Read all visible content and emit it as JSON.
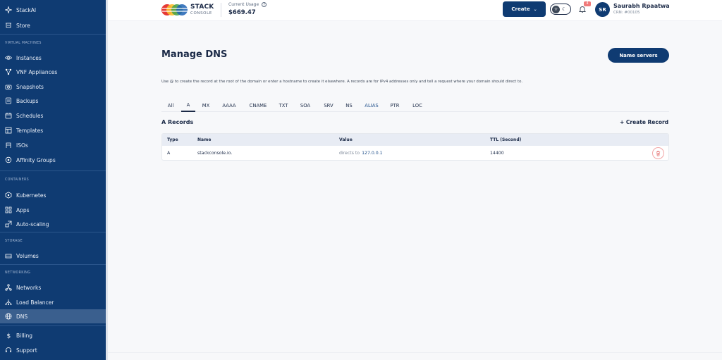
{
  "sidebar": {
    "top_items": [
      {
        "label": "StackAI",
        "icon": "sparkle-icon"
      },
      {
        "label": "Store",
        "icon": "store-icon"
      }
    ],
    "sections": [
      {
        "title": "VIRTUAL MACHINES",
        "items": [
          {
            "label": "Instances",
            "icon": "eye-icon"
          },
          {
            "label": "VNF Appliances",
            "icon": "nodes-icon"
          },
          {
            "label": "Snapshots",
            "icon": "camera-icon"
          },
          {
            "label": "Backups",
            "icon": "backup-icon"
          },
          {
            "label": "Schedules",
            "icon": "calendar-icon"
          },
          {
            "label": "Templates",
            "icon": "template-icon"
          },
          {
            "label": "ISOs",
            "icon": "disc-icon"
          },
          {
            "label": "Affinity Groups",
            "icon": "affinity-icon"
          }
        ]
      },
      {
        "title": "CONTAINERS",
        "items": [
          {
            "label": "Kubernetes",
            "icon": "kubernetes-icon"
          },
          {
            "label": "Apps",
            "icon": "apps-icon"
          },
          {
            "label": "Auto-scaling",
            "icon": "autoscale-icon"
          }
        ]
      },
      {
        "title": "STORAGE",
        "items": [
          {
            "label": "Volumes",
            "icon": "volume-icon"
          }
        ]
      },
      {
        "title": "NETWORKING",
        "items": [
          {
            "label": "Networks",
            "icon": "network-icon"
          },
          {
            "label": "Load Balancer",
            "icon": "load-balancer-icon"
          },
          {
            "label": "DNS",
            "icon": "globe-icon"
          }
        ]
      }
    ],
    "bottom_items": [
      {
        "label": "Billing",
        "icon": "dollar-icon"
      },
      {
        "label": "Support",
        "icon": "headset-icon"
      }
    ],
    "active": "DNS"
  },
  "header": {
    "brand": "STACK",
    "brand_sub": "CONSOLE",
    "usage_label": "Current Usage",
    "usage_help": "?",
    "usage_value": "$669.47",
    "create_label": "Create",
    "notification_count": "4",
    "avatar_initials": "SR",
    "user_name": "Saurabh Rpaatwa",
    "user_crn": "CRN: #00105"
  },
  "main": {
    "title": "Manage DNS",
    "nameservers_label": "Name servers",
    "description": "Use @ to create the record at the root of the domain or enter a hostname to create it elsewhere. A records are for IPv4 addresses only and tell a request where your domain should direct to.",
    "tabs": [
      "All",
      "A",
      "MX",
      "AAAA",
      "CNAME",
      "TXT",
      "SOA",
      "SRV",
      "NS",
      "ALIAS",
      "PTR",
      "LOC"
    ],
    "active_tab": "A",
    "section_title": "A Records",
    "create_record_label": "+ Create Record",
    "table": {
      "columns": [
        "Type",
        "Name",
        "Value",
        "TTL (Second)"
      ],
      "rows": [
        {
          "type": "A",
          "name": "stackconsole.io.",
          "value_prefix": "directs to",
          "value": "127.0.0.1",
          "ttl": "14400"
        }
      ]
    }
  },
  "colors": {
    "sidebar": "#0f3b72",
    "sidebar_active": "#3a5f8e",
    "primary": "#0f3b72",
    "danger": "#e57373"
  }
}
